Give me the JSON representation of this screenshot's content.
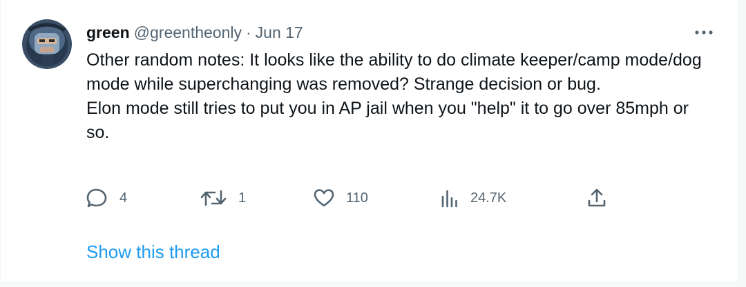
{
  "tweet": {
    "author_name": "green",
    "author_handle": "@greentheonly",
    "separator": "·",
    "date": "Jun 17",
    "paragraphs": [
      "Other random notes: It looks like the ability to do climate keeper/camp mode/dog mode while superchanging was removed? Strange decision or bug.",
      "Elon mode still tries to put you in AP jail when you \"help\" it to go over 85mph or so."
    ],
    "actions": {
      "replies": "4",
      "retweets": "1",
      "likes": "110",
      "views": "24.7K"
    },
    "show_thread": "Show this thread"
  },
  "icons": {
    "avatar": "avatar-helmet",
    "more": "more-dots-icon",
    "reply": "reply-bubble-icon",
    "retweet": "retweet-icon",
    "like": "heart-icon",
    "views": "analytics-bars-icon",
    "share": "share-upload-icon"
  },
  "colors": {
    "text": "#0f1419",
    "secondary": "#536471",
    "link": "#1d9bf0",
    "background": "#ffffff"
  }
}
